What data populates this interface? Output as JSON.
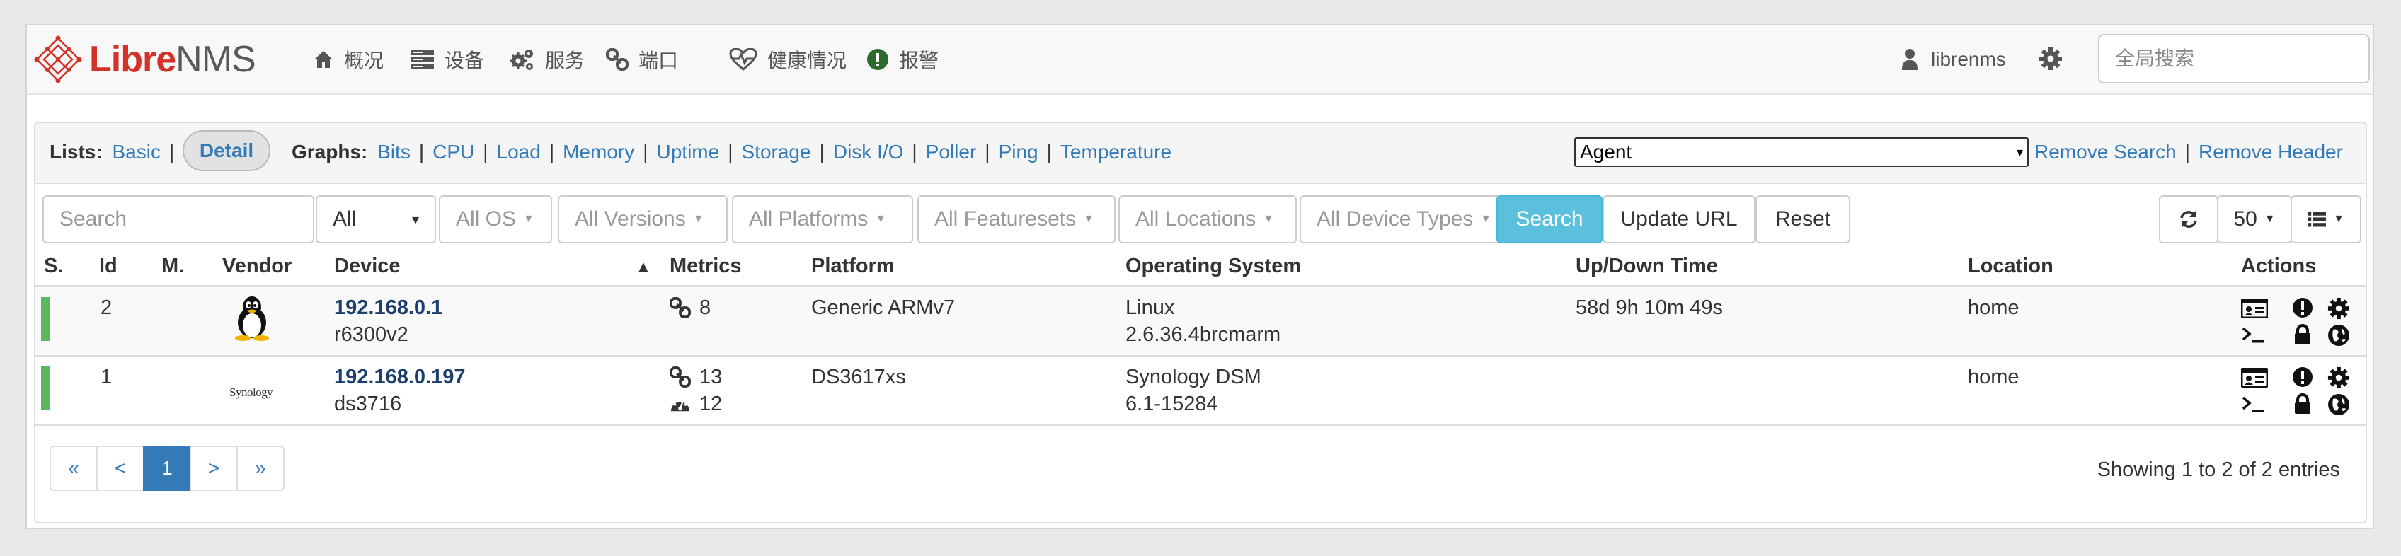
{
  "nav": {
    "logo_a": "Libre",
    "logo_b": "NMS",
    "items": [
      {
        "label": "概况",
        "icon": "home-icon"
      },
      {
        "label": "设备",
        "icon": "server-icon"
      },
      {
        "label": "服务",
        "icon": "cogs-icon"
      },
      {
        "label": "端口",
        "icon": "link-icon"
      },
      {
        "label": "健康情况",
        "icon": "heartbeat-icon"
      },
      {
        "label": "报警",
        "icon": "alert-icon"
      }
    ],
    "user": "librenms",
    "search_placeholder": "全局搜索"
  },
  "panel": {
    "lists_label": "Lists:",
    "basic": "Basic",
    "detail": "Detail",
    "graphs_label": "Graphs:",
    "graphs": [
      "Bits",
      "CPU",
      "Load",
      "Memory",
      "Uptime",
      "Storage",
      "Disk I/O",
      "Poller",
      "Ping",
      "Temperature"
    ],
    "agent_select": "Agent",
    "remove_search": "Remove Search",
    "remove_header": "Remove Header"
  },
  "toolbar": {
    "search_placeholder": "Search",
    "state": "All",
    "os": "All OS",
    "versions": "All Versions",
    "platforms": "All Platforms",
    "featuresets": "All Featuresets",
    "locations": "All Locations",
    "device_types": "All Device Types",
    "search_btn": "Search",
    "update_url": "Update URL",
    "reset": "Reset",
    "per_page": "50"
  },
  "columns": {
    "status": "S.",
    "id": "Id",
    "maint": "M.",
    "vendor": "Vendor",
    "device": "Device",
    "metrics": "Metrics",
    "platform": "Platform",
    "os": "Operating System",
    "uptime": "Up/Down Time",
    "location": "Location",
    "actions": "Actions"
  },
  "rows": [
    {
      "status_color": "#5cb85c",
      "id": "2",
      "vendor_icon": "linux-tux-logo",
      "hostname": "192.168.0.1",
      "sysname": "r6300v2",
      "metric_ports": "8",
      "platform": "Generic ARMv7",
      "os_name": "Linux",
      "os_version": "2.6.36.4brcmarm",
      "uptime": "58d 9h 10m 49s",
      "location": "home"
    },
    {
      "status_color": "#5cb85c",
      "id": "1",
      "vendor_logo_text": "Synology",
      "hostname": "192.168.0.197",
      "sysname": "ds3716",
      "metric_ports": "13",
      "metric_sensors": "12",
      "platform": "DS3617xs",
      "os_name": "Synology DSM",
      "os_version": "6.1-15284",
      "uptime": "",
      "location": "home"
    }
  ],
  "pagination": {
    "first": "«",
    "prev": "<",
    "current": "1",
    "next": ">",
    "last": "»",
    "info": "Showing 1 to 2 of 2 entries"
  }
}
